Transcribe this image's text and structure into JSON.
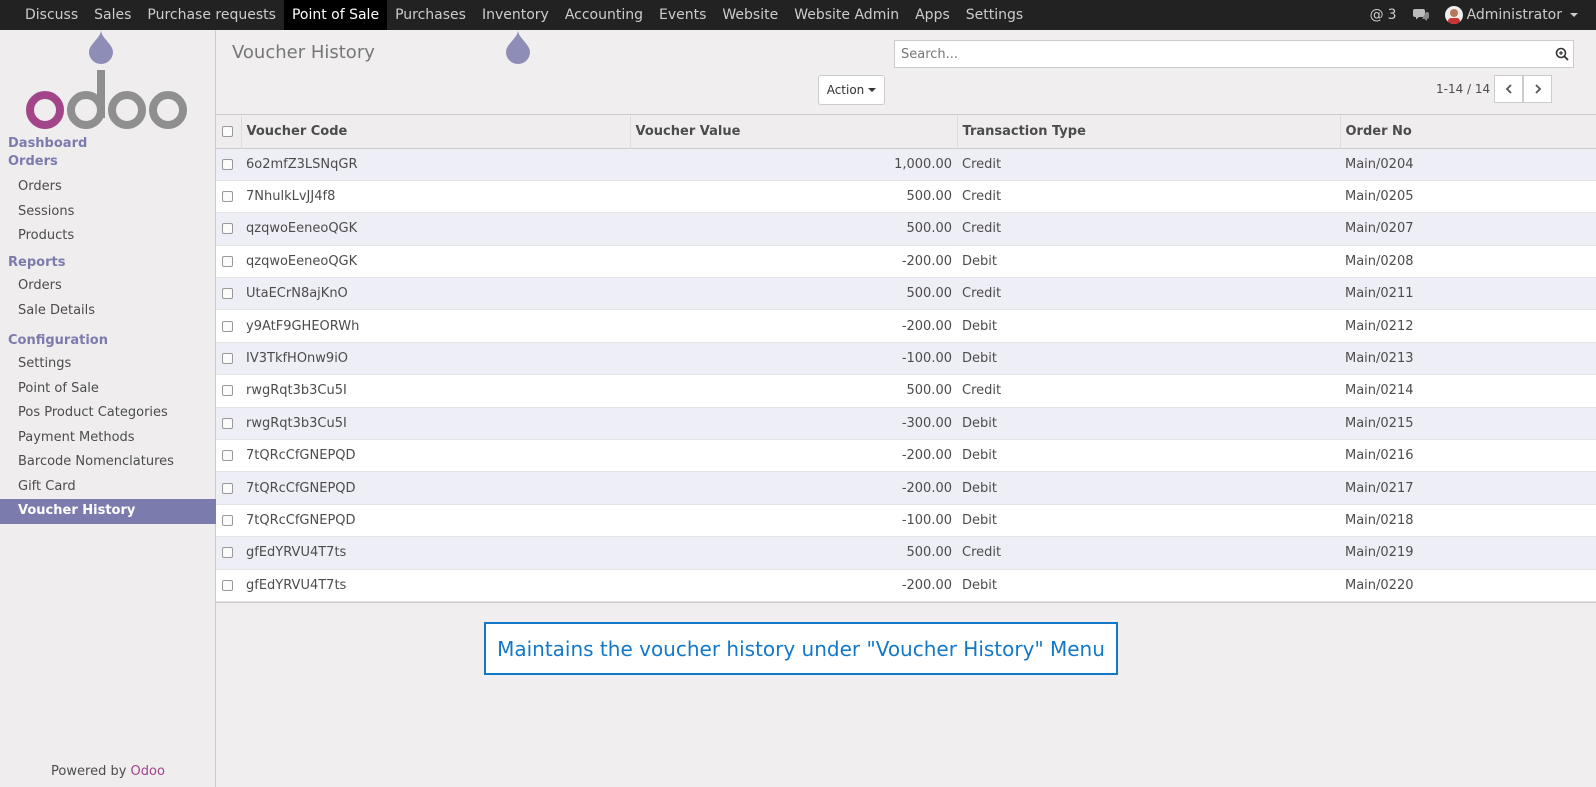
{
  "topbar": {
    "menu": [
      "Discuss",
      "Sales",
      "Purchase requests",
      "Point of Sale",
      "Purchases",
      "Inventory",
      "Accounting",
      "Events",
      "Website",
      "Website Admin",
      "Apps",
      "Settings"
    ],
    "active_menu": "Point of Sale",
    "mentions_count": "3",
    "user_name": "Administrator"
  },
  "sidebar": {
    "dashboard": "Dashboard",
    "orders_header": "Orders",
    "orders_items": [
      "Orders",
      "Sessions",
      "Products"
    ],
    "reports_header": "Reports",
    "reports_items": [
      "Orders",
      "Sale Details"
    ],
    "config_header": "Configuration",
    "config_items": [
      "Settings",
      "Point of Sale",
      "Pos Product Categories",
      "Payment Methods",
      "Barcode Nomenclatures",
      "Gift Card",
      "Voucher History"
    ],
    "active_item": "Voucher History",
    "powered_by": "Powered by",
    "powered_brand": "Odoo"
  },
  "control_panel": {
    "title": "Voucher History",
    "search_placeholder": "Search...",
    "action_label": "Action",
    "pager_value": "1-14 / 14"
  },
  "table": {
    "columns": [
      "Voucher Code",
      "Voucher Value",
      "Transaction Type",
      "Order No"
    ],
    "rows": [
      [
        "6o2mfZ3LSNqGR",
        "1,000.00",
        "Credit",
        "Main/0204"
      ],
      [
        "7NhulkLvJJ4f8",
        "500.00",
        "Credit",
        "Main/0205"
      ],
      [
        "qzqwoEeneoQGK",
        "500.00",
        "Credit",
        "Main/0207"
      ],
      [
        "qzqwoEeneoQGK",
        "-200.00",
        "Debit",
        "Main/0208"
      ],
      [
        "UtaECrN8ajKnO",
        "500.00",
        "Credit",
        "Main/0211"
      ],
      [
        "y9AtF9GHEORWh",
        "-200.00",
        "Debit",
        "Main/0212"
      ],
      [
        "IV3TkfHOnw9iO",
        "-100.00",
        "Debit",
        "Main/0213"
      ],
      [
        "rwgRqt3b3Cu5I",
        "500.00",
        "Credit",
        "Main/0214"
      ],
      [
        "rwgRqt3b3Cu5I",
        "-300.00",
        "Debit",
        "Main/0215"
      ],
      [
        "7tQRcCfGNEPQD",
        "-200.00",
        "Debit",
        "Main/0216"
      ],
      [
        "7tQRcCfGNEPQD",
        "-200.00",
        "Debit",
        "Main/0217"
      ],
      [
        "7tQRcCfGNEPQD",
        "-100.00",
        "Debit",
        "Main/0218"
      ],
      [
        "gfEdYRVU4T7ts",
        "500.00",
        "Credit",
        "Main/0219"
      ],
      [
        "gfEdYRVU4T7ts",
        "-200.00",
        "Debit",
        "Main/0220"
      ]
    ]
  },
  "callout": "Maintains the voucher history under \"Voucher History\" Menu",
  "colors": {
    "accent": "#7c7bad",
    "brand": "#a24689",
    "callout": "#1478c8"
  }
}
